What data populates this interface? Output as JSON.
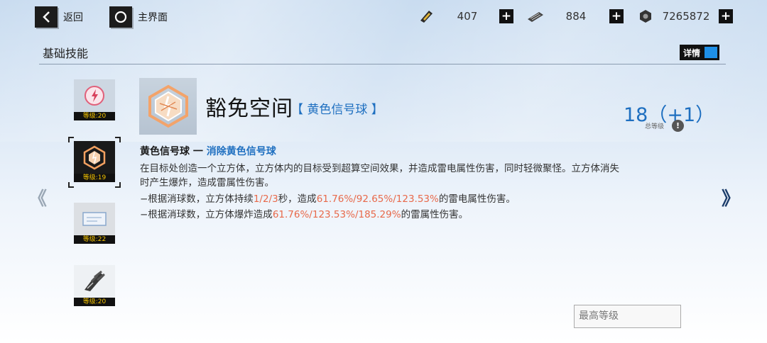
{
  "nav": {
    "back_label": "返回",
    "home_label": "主界面"
  },
  "resources": [
    {
      "icon": "gold-ticket-icon",
      "value": "407"
    },
    {
      "icon": "ammo-clip-icon",
      "value": "884"
    },
    {
      "icon": "hex-nut-icon",
      "value": "7265872"
    }
  ],
  "section": {
    "title": "基础技能",
    "details_label": "详情"
  },
  "skills": [
    {
      "name": "skill-slot-1",
      "icon": "lightning-orb-icon",
      "level": "等级:20"
    },
    {
      "name": "skill-slot-2",
      "icon": "cube-burst-icon",
      "level": "等级:19"
    },
    {
      "name": "skill-slot-3",
      "icon": "card-icon",
      "level": "等级:22"
    },
    {
      "name": "skill-slot-4",
      "icon": "claw-gauntlet-icon",
      "level": "等级:20"
    }
  ],
  "selected_skill": {
    "name": "豁免空间",
    "tag": "【 黄色信号球 】",
    "level": "18（+1）",
    "level_caption": "总等级",
    "desc_head_black": "黄色信号球 一 ",
    "desc_head_blue": "消除黄色信号球",
    "desc_line1": "在目标处创造一个立方体，立方体内的目标受到超算空间效果，并造成雷电属性伤害，同时轻微聚怪。立方体消失",
    "desc_line2": "时产生爆炸，造成雷属性伤害。",
    "line3": {
      "a": "−根据消球数，立方体持续",
      "b": "1/2/3",
      "c": "秒，造成",
      "d": "61.76%",
      "e": "/",
      "f": "92.65%",
      "g": "/",
      "h": "123.53%",
      "i": "的雷电属性伤害。"
    },
    "line4": {
      "a": "−根据消球数，立方体爆炸造成",
      "b": "61.76%",
      "c": "/",
      "d": "123.53%",
      "e": "/",
      "f": "185.29%",
      "g": "的雷属性伤害。"
    }
  },
  "max_level_label": "最高等级",
  "colors": {
    "accent_blue": "#1e6fc0",
    "highlight_red": "#e8694a",
    "level_yellow": "#f5c400"
  }
}
